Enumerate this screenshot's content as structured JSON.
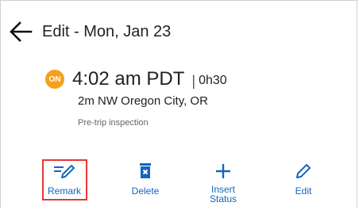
{
  "header": {
    "title": "Edit - Mon, Jan 23"
  },
  "entry": {
    "status_badge": "ON",
    "time": "4:02 am PDT",
    "separator": "|",
    "duration": "0h30",
    "location": "2m NW Oregon City, OR",
    "note": "Pre-trip inspection"
  },
  "actions": {
    "remark": "Remark",
    "delete": "Delete",
    "insert_status": "Insert\nStatus",
    "edit": "Edit"
  },
  "colors": {
    "badge": "#f5a01a",
    "action_blue": "#1565c0",
    "highlight": "#e53935"
  },
  "icons": {
    "back": "arrow-left-icon",
    "remark": "remark-pencil-icon",
    "delete": "trash-icon",
    "insert": "plus-icon",
    "edit": "pencil-icon"
  }
}
